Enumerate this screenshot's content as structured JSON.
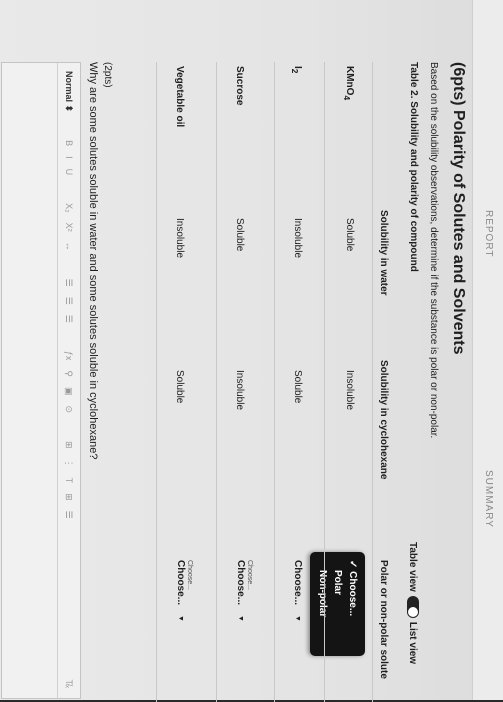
{
  "tabs": {
    "report": "REPORT",
    "summary": "SUMMARY"
  },
  "title": "(6pts) Polarity of Solutes and Solvents",
  "instructions": "Based on the solubility observations, determine if the substance is polar or non-polar.",
  "table_caption": "Table 2. Solubility and polarity of compound",
  "view_toggle": {
    "table_label": "Table view",
    "list_label": "List view"
  },
  "table": {
    "headers": [
      "Solubility in water",
      "Solubility in cyclohexane",
      "Polar or non-polar solute"
    ],
    "rows": [
      {
        "name": "KMnO",
        "name_sub": "4",
        "water": "Soluble",
        "cyclohexane": "Insoluble",
        "select": "Choose..."
      },
      {
        "name": "I",
        "name_sub": "2",
        "water": "Insoluble",
        "cyclohexane": "Soluble",
        "select": "Choose..."
      },
      {
        "name": "Sucrose",
        "name_sub": "",
        "water": "Soluble",
        "cyclohexane": "Insoluble",
        "select": "Choose...",
        "tiny": "Choose..."
      },
      {
        "name": "Vegetable oil",
        "name_sub": "",
        "water": "Insoluble",
        "cyclohexane": "Soluble",
        "select": "Choose...",
        "tiny": "Choose..."
      }
    ]
  },
  "dropdown": {
    "selected": "✓ Choose...",
    "options": [
      "Polar",
      "Non-polar"
    ]
  },
  "question": {
    "points": "(2pts)",
    "text": "Why are some solutes soluble in water and some solutes soluble in cyclohexane?"
  },
  "toolbar": {
    "style": "Normal",
    "style_caret": "⬍",
    "buttons": [
      "B",
      "I",
      "U",
      "X₂",
      "X²",
      "↔",
      "☰",
      "☰",
      "☰",
      "ƒx",
      "⚲",
      "▣",
      "⊙",
      "⊞",
      "⋮",
      "T",
      "⊞",
      "☰",
      "T̸ₓ"
    ]
  },
  "colors": {
    "dropdown_bg": "#141414",
    "page_bg": "#e9e9e9"
  }
}
